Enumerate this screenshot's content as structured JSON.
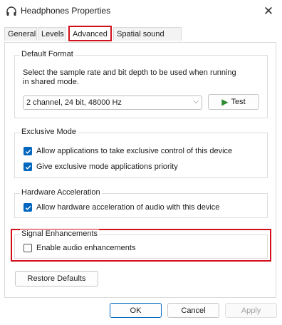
{
  "window": {
    "title": "Headphones Properties",
    "icon": "headphones-icon",
    "close_icon": "close-icon"
  },
  "tabs": [
    {
      "label": "General",
      "active": false
    },
    {
      "label": "Levels",
      "active": false
    },
    {
      "label": "Advanced",
      "active": true
    },
    {
      "label": "Spatial sound",
      "active": false
    }
  ],
  "default_format": {
    "label": "Default Format",
    "description_line1": "Select the sample rate and bit depth to be used when running",
    "description_line2": "in shared mode.",
    "selected": "2 channel, 24 bit, 48000 Hz",
    "test_label": "Test"
  },
  "exclusive_mode": {
    "label": "Exclusive Mode",
    "options": [
      {
        "label": "Allow applications to take exclusive control of this device",
        "checked": true
      },
      {
        "label": "Give exclusive mode applications priority",
        "checked": true
      }
    ]
  },
  "hardware_acceleration": {
    "label": "Hardware Acceleration",
    "option": {
      "label": "Allow hardware acceleration of audio with this device",
      "checked": true
    }
  },
  "signal_enhancements": {
    "label": "Signal Enhancements",
    "option": {
      "label": "Enable audio enhancements",
      "checked": false
    }
  },
  "restore_defaults_label": "Restore Defaults",
  "footer": {
    "ok": "OK",
    "cancel": "Cancel",
    "apply": "Apply"
  },
  "colors": {
    "highlight": "#d0101b",
    "accent": "#0067c0"
  }
}
